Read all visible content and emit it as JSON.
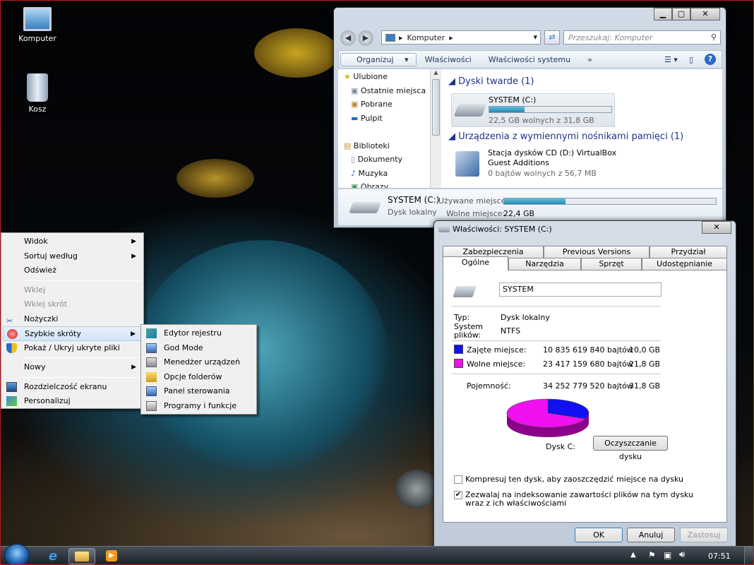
{
  "desktop": {
    "icons": [
      {
        "label": "Komputer"
      },
      {
        "label": "Kosz"
      }
    ]
  },
  "explorer": {
    "address_label": "Komputer",
    "search_placeholder": "Przeszukaj: Komputer",
    "toolbar": {
      "organize": "Organizuj",
      "properties": "Właściwości",
      "system_properties": "Właściwości systemu",
      "more": "»"
    },
    "nav": [
      "Ulubione",
      "Ostatnie miejsca",
      "Pobrane",
      "Pulpit",
      "",
      "Biblioteki",
      "Dokumenty",
      "Muzyka",
      "Obrazy"
    ],
    "group_hdd": "Dyski twarde (1)",
    "drive_c": {
      "name": "SYSTEM (C:)",
      "free_text": "22,5 GB wolnych z 31,8 GB",
      "used_fraction": 0.29
    },
    "group_removable": "Urządzenia z wymiennymi nośnikami pamięci (1)",
    "drive_d": {
      "name_line1": "Stacja dysków CD (D:) VirtualBox",
      "name_line2": "Guest Additions",
      "free_text": "0 bajtów wolnych z 56,7 MB"
    },
    "details": {
      "name": "SYSTEM (C:)",
      "type": "Dysk lokalny",
      "used_label": "Używane miejsce:",
      "free_label": "Wolne miejsce:",
      "free_value": "22,4 GB",
      "used_fraction": 0.29
    }
  },
  "context_menu": {
    "items": [
      "Widok",
      "Sortuj według",
      "Odśwież",
      "Wklej",
      "Wklej skrót",
      "Nożyczki",
      "Szybkie skróty",
      "Pokaż / Ukryj ukryte pliki",
      "Nowy",
      "Rozdzielczość ekranu",
      "Personalizuj"
    ],
    "arrow": "▶"
  },
  "submenu": {
    "items": [
      "Edytor rejestru",
      "God Mode",
      "Menedżer urządzeń",
      "Opcje folderów",
      "Panel sterowania",
      "Programy i funkcje"
    ]
  },
  "properties": {
    "title": "Właściwości: SYSTEM (C:)",
    "tabs_top": [
      "Zabezpieczenia",
      "Previous Versions",
      "Przydział"
    ],
    "tabs_bottom": [
      "Ogólne",
      "Narzędzia",
      "Sprzęt",
      "Udostępnianie"
    ],
    "volume_name": "SYSTEM",
    "type_label": "Typ:",
    "type_value": "Dysk lokalny",
    "fs_label_1": "System",
    "fs_label_2": "plików:",
    "fs_value": "NTFS",
    "used_label": "Zajęte miejsce:",
    "used_bytes": "10 835 619 840 bajtów",
    "used_gb": "10,0 GB",
    "free_label": "Wolne miejsce:",
    "free_bytes": "23 417 159 680 bajtów",
    "free_gb": "21,8 GB",
    "cap_label": "Pojemność:",
    "cap_bytes": "34 252 779 520 bajtów",
    "cap_gb": "31,8 GB",
    "disk_label": "Dysk C:",
    "cleanup": "Oczyszczanie dysku",
    "compress": "Kompresuj ten dysk, aby zaoszczędzić miejsce na dysku",
    "index_1": "Zezwalaj na indeksowanie zawartości plików na tym dysku",
    "index_2": "wraz z ich właściwościami",
    "ok": "OK",
    "cancel": "Anuluj",
    "apply": "Zastosuj",
    "colors": {
      "used": "#1010f0",
      "free": "#f010f0"
    },
    "pie": {
      "used_fraction": 0.316,
      "free_fraction": 0.684
    }
  },
  "taskbar": {
    "time": "07:51"
  }
}
